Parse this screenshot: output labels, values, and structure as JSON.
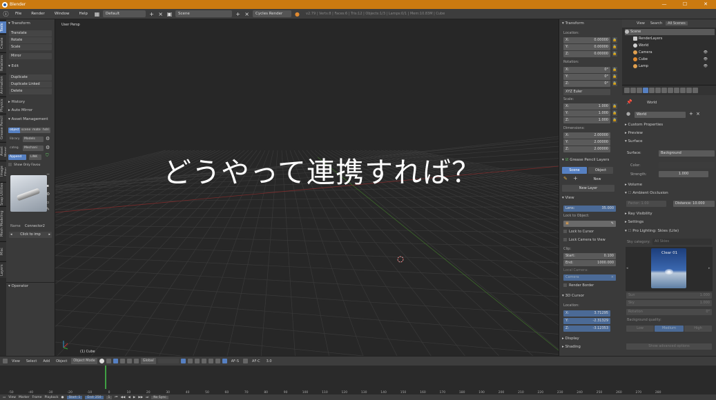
{
  "app": {
    "title": "Blender",
    "window_buttons": [
      "—",
      "☐",
      "✕"
    ]
  },
  "topbar": {
    "menus": [
      "File",
      "Render",
      "Window",
      "Help"
    ],
    "layout": "Default",
    "scene": "Scene",
    "engine": "Cycles Render",
    "info": "v2.79 | Verts:8 | Faces:6 | Tris:12 | Objects:1/3 | Lamps:0/1 | Mem:10.83M | Cube"
  },
  "vtabs": [
    "Tools",
    "Create",
    "Relations",
    "Animation",
    "Physics",
    "Grease Pencil",
    "Asset Mgmt",
    "Image Filter",
    "Snap Utilities",
    "Mesh Modeling",
    "Misc",
    "Layers"
  ],
  "toolshelf": {
    "transform_header": "Transform",
    "transform_items": [
      "Translate",
      "Rotate",
      "Scale",
      "Mirror"
    ],
    "edit_header": "Edit",
    "edit_items": [
      "Duplicate",
      "Duplicate Linked",
      "Delete"
    ],
    "history_header": "History",
    "automirror_header": "Auto Mirror",
    "asset_header": "Asset Management",
    "asset_tabs": [
      "object",
      "scene",
      "mate",
      "hdri"
    ],
    "library_label": "library",
    "library_value": "Models",
    "category_label": "categ.",
    "category_value": "Mechani",
    "append": "Append",
    "link": "LINK",
    "show_only": "Show Only Favou",
    "name_label": "Name",
    "name_value": "Connector2",
    "click_to_import": "Click to imp",
    "operator_header": "Operator"
  },
  "viewport": {
    "label": "User Persp",
    "object": "(1) Cube",
    "overlay_text": "どうやって連携すれば？"
  },
  "npanel": {
    "transform_header": "Transform",
    "location_label": "Location:",
    "location": [
      {
        "axis": "X:",
        "value": "0.00000"
      },
      {
        "axis": "Y:",
        "value": "0.00000"
      },
      {
        "axis": "Z:",
        "value": "0.00000"
      }
    ],
    "rotation_label": "Rotation:",
    "rotation": [
      {
        "axis": "X:",
        "value": "0°"
      },
      {
        "axis": "Y:",
        "value": "0°"
      },
      {
        "axis": "Z:",
        "value": "0°"
      }
    ],
    "rotation_mode": "XYZ Euler",
    "scale_label": "Scale:",
    "scale": [
      {
        "axis": "X:",
        "value": "1.000"
      },
      {
        "axis": "Y:",
        "value": "1.000"
      },
      {
        "axis": "Z:",
        "value": "1.000"
      }
    ],
    "dimensions_label": "Dimensions:",
    "dimensions": [
      {
        "axis": "X:",
        "value": "2.00000"
      },
      {
        "axis": "Y:",
        "value": "2.00000"
      },
      {
        "axis": "Z:",
        "value": "2.00000"
      }
    ],
    "grease_header": "Grease Pencil Layers",
    "grease_scene": "Scene",
    "grease_object": "Object",
    "grease_new": "New",
    "grease_new_layer": "New Layer",
    "view_header": "View",
    "lens_label": "Lens:",
    "lens_value": "35.000",
    "lock_label": "Lock to Object:",
    "lock_cursor": "Lock to Cursor",
    "lock_camera": "Lock Camera to View",
    "clip_label": "Clip:",
    "clip_start_label": "Start:",
    "clip_start": "0.100",
    "clip_end_label": "End:",
    "clip_end": "1000.000",
    "local_camera": "Local Camera:",
    "camera_value": "Camera",
    "render_border": "Render Border",
    "cursor_header": "3D Cursor",
    "cursor_location": "Location:",
    "cursor": [
      {
        "axis": "X:",
        "value": "3.71295"
      },
      {
        "axis": "Y:",
        "value": "-2.31329"
      },
      {
        "axis": "Z:",
        "value": "-3.12353"
      }
    ],
    "display_header": "Display",
    "shading_header": "Shading"
  },
  "outliner": {
    "tabs": [
      "View",
      "Search",
      "All Scenes"
    ],
    "rows": [
      {
        "label": "Scene",
        "color": "#bbbbbb",
        "indent": 0
      },
      {
        "label": "RenderLayers",
        "color": "#cccccc",
        "indent": 1
      },
      {
        "label": "World",
        "color": "#d0d0d0",
        "indent": 1
      },
      {
        "label": "Camera",
        "color": "#e0a050",
        "indent": 1
      },
      {
        "label": "Cube",
        "color": "#e08a30",
        "indent": 1
      },
      {
        "label": "Lamp",
        "color": "#e0a050",
        "indent": 1
      }
    ]
  },
  "props": {
    "world_label": "World",
    "world_field": "World",
    "custom_props": "Custom Properties",
    "preview": "Preview",
    "surface": "Surface",
    "surface_label": "Surface:",
    "surface_value": "Background",
    "color_label": "Color:",
    "strength_label": "Strength:",
    "strength_value": "1.000",
    "volume": "Volume",
    "ao": "Ambient Occlusion",
    "ao_factor": "Factor:",
    "ao_factor_value": "1.00",
    "ao_distance": "Distance:",
    "ao_distance_value": "10.000",
    "ray_visibility": "Ray Visibility",
    "settings": "Settings",
    "pro_lighting": "Pro Lighting: Skies (Lite)",
    "sky_category_label": "Sky category:",
    "sky_category_value": "All Skies",
    "sky_name": "Clear 01",
    "sun_label": "Sun",
    "sun_value": "1.000",
    "sky_label": "Sky",
    "sky_value": "1.000",
    "rotation_label": "Rotation",
    "rotation_value": "0°",
    "bg_quality": "Background quality:",
    "quality_low": "Low",
    "quality_medium": "Medium",
    "quality_high": "High",
    "show_advanced": "Show advanced options"
  },
  "view3dbar": {
    "items": [
      "View",
      "Select",
      "Add",
      "Object"
    ],
    "mode": "Object Mode",
    "pivot": "Global",
    "af": "AF-S",
    "afc": "AF-C",
    "version": "3.0"
  },
  "timeline": {
    "ticks": [
      "-50",
      "-40",
      "-30",
      "-20",
      "-10",
      "0",
      "10",
      "20",
      "30",
      "40",
      "50",
      "60",
      "70",
      "80",
      "90",
      "100",
      "110",
      "120",
      "130",
      "140",
      "150",
      "160",
      "170",
      "180",
      "190",
      "200",
      "210",
      "220",
      "230",
      "240",
      "250",
      "260",
      "270",
      "280"
    ],
    "current_frame": 1,
    "bottom": [
      "View",
      "Marker",
      "Frame",
      "Playback"
    ],
    "start_label": "Start:",
    "start": "1",
    "end_label": "End:",
    "end": "250",
    "frame": "1",
    "sync": "No Sync"
  }
}
